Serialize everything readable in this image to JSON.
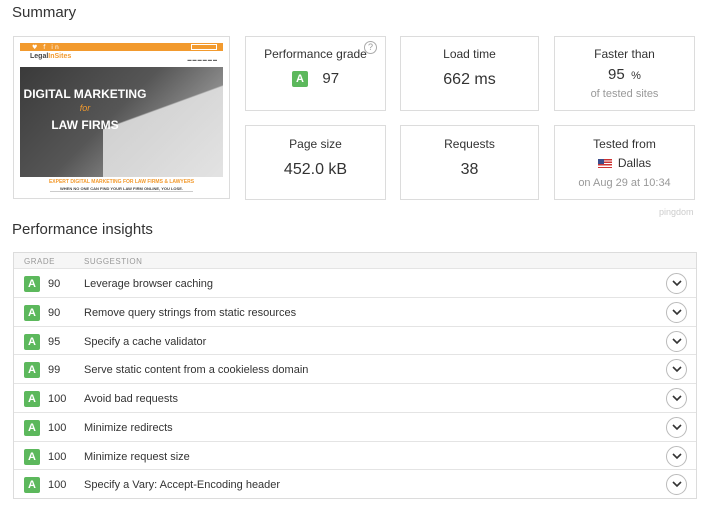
{
  "summary": {
    "title": "Summary"
  },
  "site_preview": {
    "logo_prefix": "Legal",
    "logo_suffix": "InSites",
    "headline_line1": "DIGITAL MARKETING",
    "headline_line2": "for",
    "headline_line3": "LAW FIRMS",
    "tagline": "EXPERT DIGITAL MARKETING FOR LAW FIRMS & LAWYERS",
    "subtagline": "WHEN NO ONE CAN FIND YOUR LAW FIRM ONLINE, YOU LOSE."
  },
  "cards": {
    "performance_grade": {
      "label": "Performance grade",
      "grade": "A",
      "value": "97",
      "help": "?"
    },
    "load_time": {
      "label": "Load time",
      "value": "662 ms"
    },
    "faster_than": {
      "label": "Faster than",
      "value": "95",
      "unit": "%",
      "sub": "of tested sites"
    },
    "page_size": {
      "label": "Page size",
      "value": "452.0 kB"
    },
    "requests": {
      "label": "Requests",
      "value": "38"
    },
    "tested_from": {
      "label": "Tested from",
      "location": "Dallas",
      "sub": "on Aug 29 at 10:34"
    }
  },
  "branding": "pingdom",
  "insights": {
    "title": "Performance insights",
    "columns": {
      "grade": "GRADE",
      "suggestion": "SUGGESTION"
    },
    "rows": [
      {
        "grade": "A",
        "score": "90",
        "suggestion": "Leverage browser caching"
      },
      {
        "grade": "A",
        "score": "90",
        "suggestion": "Remove query strings from static resources"
      },
      {
        "grade": "A",
        "score": "95",
        "suggestion": "Specify a cache validator"
      },
      {
        "grade": "A",
        "score": "99",
        "suggestion": "Serve static content from a cookieless domain"
      },
      {
        "grade": "A",
        "score": "100",
        "suggestion": "Avoid bad requests"
      },
      {
        "grade": "A",
        "score": "100",
        "suggestion": "Minimize redirects"
      },
      {
        "grade": "A",
        "score": "100",
        "suggestion": "Minimize request size"
      },
      {
        "grade": "A",
        "score": "100",
        "suggestion": "Specify a Vary: Accept-Encoding header"
      }
    ]
  },
  "colors": {
    "grade_a": "#5cb85c",
    "accent_orange": "#f29a2e"
  },
  "icons": {
    "expand": "chevron-down-icon",
    "help": "help-circle-icon",
    "flag": "us-flag-icon"
  }
}
